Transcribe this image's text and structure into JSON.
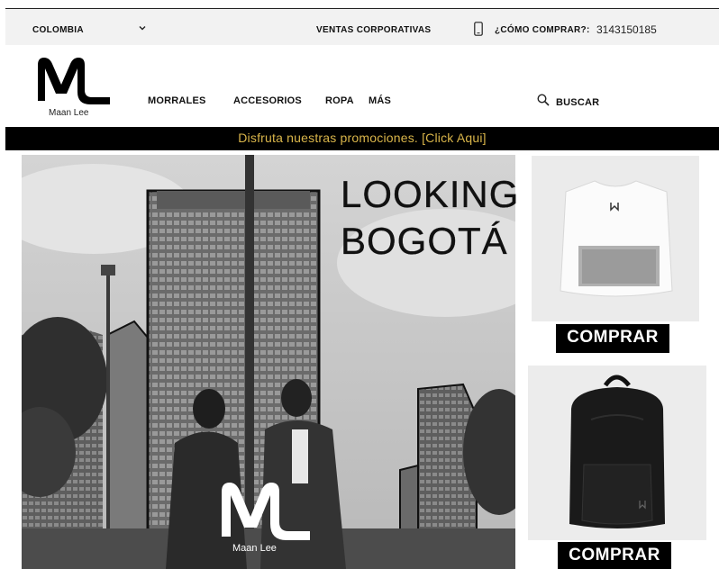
{
  "topbar": {
    "country": "COLOMBIA",
    "corporate": "VENTAS CORPORATIVAS",
    "how_to_buy": "¿CÓMO COMPRAR?:",
    "phone": "3143150185"
  },
  "header": {
    "logo_text": "Maan Lee",
    "nav": [
      "MORRALES",
      "ACCESORIOS",
      "ROPA",
      "MÁS"
    ],
    "search_label": "BUSCAR"
  },
  "promo": {
    "text": "Disfruta nuestras promociones. [Click Aqui]"
  },
  "hero": {
    "title_line1": "LOOKING",
    "title_line2": "BOGOTÁ",
    "logo_text": "Maan Lee"
  },
  "products": {
    "buy_label_1": "COMPRAR",
    "buy_label_2": "COMPRAR"
  },
  "colors": {
    "promo_text": "#d9b54a",
    "promo_bg": "#000000",
    "topbar_bg": "#f2f2f2"
  }
}
